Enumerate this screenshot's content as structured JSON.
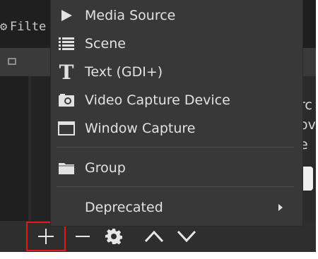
{
  "window": {
    "filter_tab_label": "Filte"
  },
  "side_panel": {
    "fragments": [
      "rc",
      "ov",
      "e"
    ]
  },
  "menu": {
    "items": [
      {
        "label": "Media Source",
        "icon": "play-icon"
      },
      {
        "label": "Scene",
        "icon": "list-icon"
      },
      {
        "label": "Text (GDI+)",
        "icon": "text-icon"
      },
      {
        "label": "Video Capture Device",
        "icon": "camera-icon"
      },
      {
        "label": "Window Capture",
        "icon": "window-icon"
      },
      {
        "label": "Group",
        "icon": "folder-icon"
      },
      {
        "label": "Deprecated",
        "icon": "submenu-arrow-icon"
      }
    ]
  },
  "toolbar": {
    "buttons": [
      "add-icon",
      "remove-icon",
      "properties-gear-icon",
      "move-up-icon",
      "move-down-icon"
    ],
    "highlight_color": "#e31a1a"
  },
  "colors": {
    "menu_bg": "#383838",
    "panel_bg": "#2b2b2b",
    "text": "#e2e2e2"
  }
}
